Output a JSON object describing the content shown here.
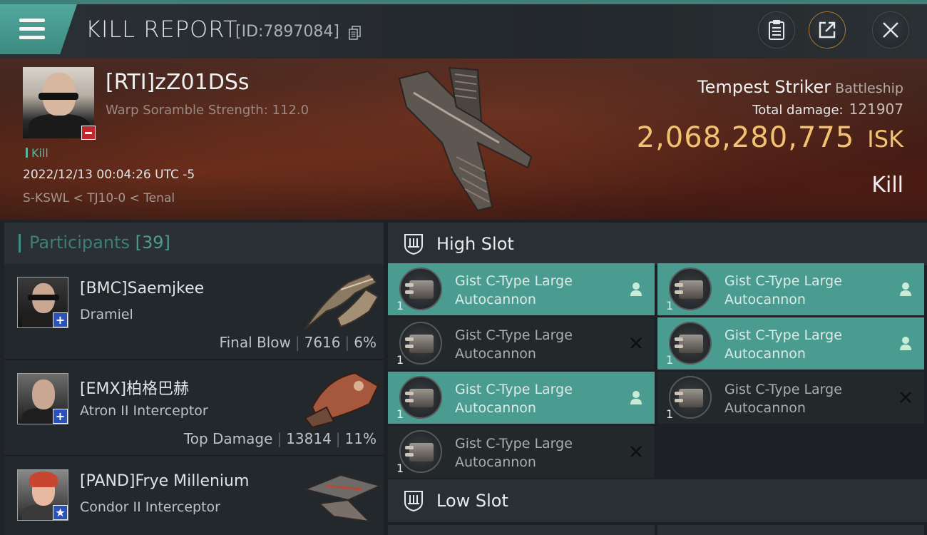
{
  "header": {
    "title": "KILL REPORT",
    "report_id": "[ID:7897084]"
  },
  "victim": {
    "name": "[RTI]zZ01DSs",
    "scramble": "Warp Soramble Strength: 112.0",
    "tag": "Kill",
    "timestamp": "2022/12/13 00:04:26 UTC -5",
    "location": "S-KSWL < TJ10-0 < Tenal",
    "ship_name": "Tempest Striker",
    "ship_class": "Battleship",
    "total_damage_label": "Total damage:",
    "total_damage": "121907",
    "isk_value": "2,068,280,775",
    "isk_unit": "ISK",
    "result": "Kill"
  },
  "participants": {
    "label": "Participants",
    "count": "[39]",
    "rows": [
      {
        "name": "[BMC]Saemjkee",
        "ship": "Dramiel",
        "role": "Final Blow",
        "damage": "7616",
        "percent": "6%",
        "badge": "+"
      },
      {
        "name": "[EMX]柏格巴赫",
        "ship": "Atron II Interceptor",
        "role": "Top Damage",
        "damage": "13814",
        "percent": "11%",
        "badge": "+"
      },
      {
        "name": "[PAND]Frye Millenium",
        "ship": "Condor II Interceptor",
        "role": "",
        "damage": "",
        "percent": "",
        "badge": "★"
      }
    ]
  },
  "fitting": {
    "high_slot_label": "High Slot",
    "low_slot_label": "Low Slot",
    "modules": [
      {
        "name": "Gist C-Type Large Autocannon",
        "qty": "1",
        "status": "person-icon",
        "active": true
      },
      {
        "name": "Gist C-Type Large Autocannon",
        "qty": "1",
        "status": "person-icon",
        "active": true
      },
      {
        "name": "Gist C-Type Large Autocannon",
        "qty": "1",
        "status": "x-icon",
        "active": false
      },
      {
        "name": "Gist C-Type Large Autocannon",
        "qty": "1",
        "status": "person-icon",
        "active": true
      },
      {
        "name": "Gist C-Type Large Autocannon",
        "qty": "1",
        "status": "person-icon",
        "active": true
      },
      {
        "name": "Gist C-Type Large Autocannon",
        "qty": "1",
        "status": "x-icon",
        "active": false
      },
      {
        "name": "Gist C-Type Large Autocannon",
        "qty": "1",
        "status": "x-icon",
        "active": false
      }
    ]
  },
  "colors": {
    "accent_teal": "#4a9c90",
    "isk_gold": "#f2c270",
    "loss_red": "#c1272d",
    "ally_blue": "#2a52b8"
  }
}
